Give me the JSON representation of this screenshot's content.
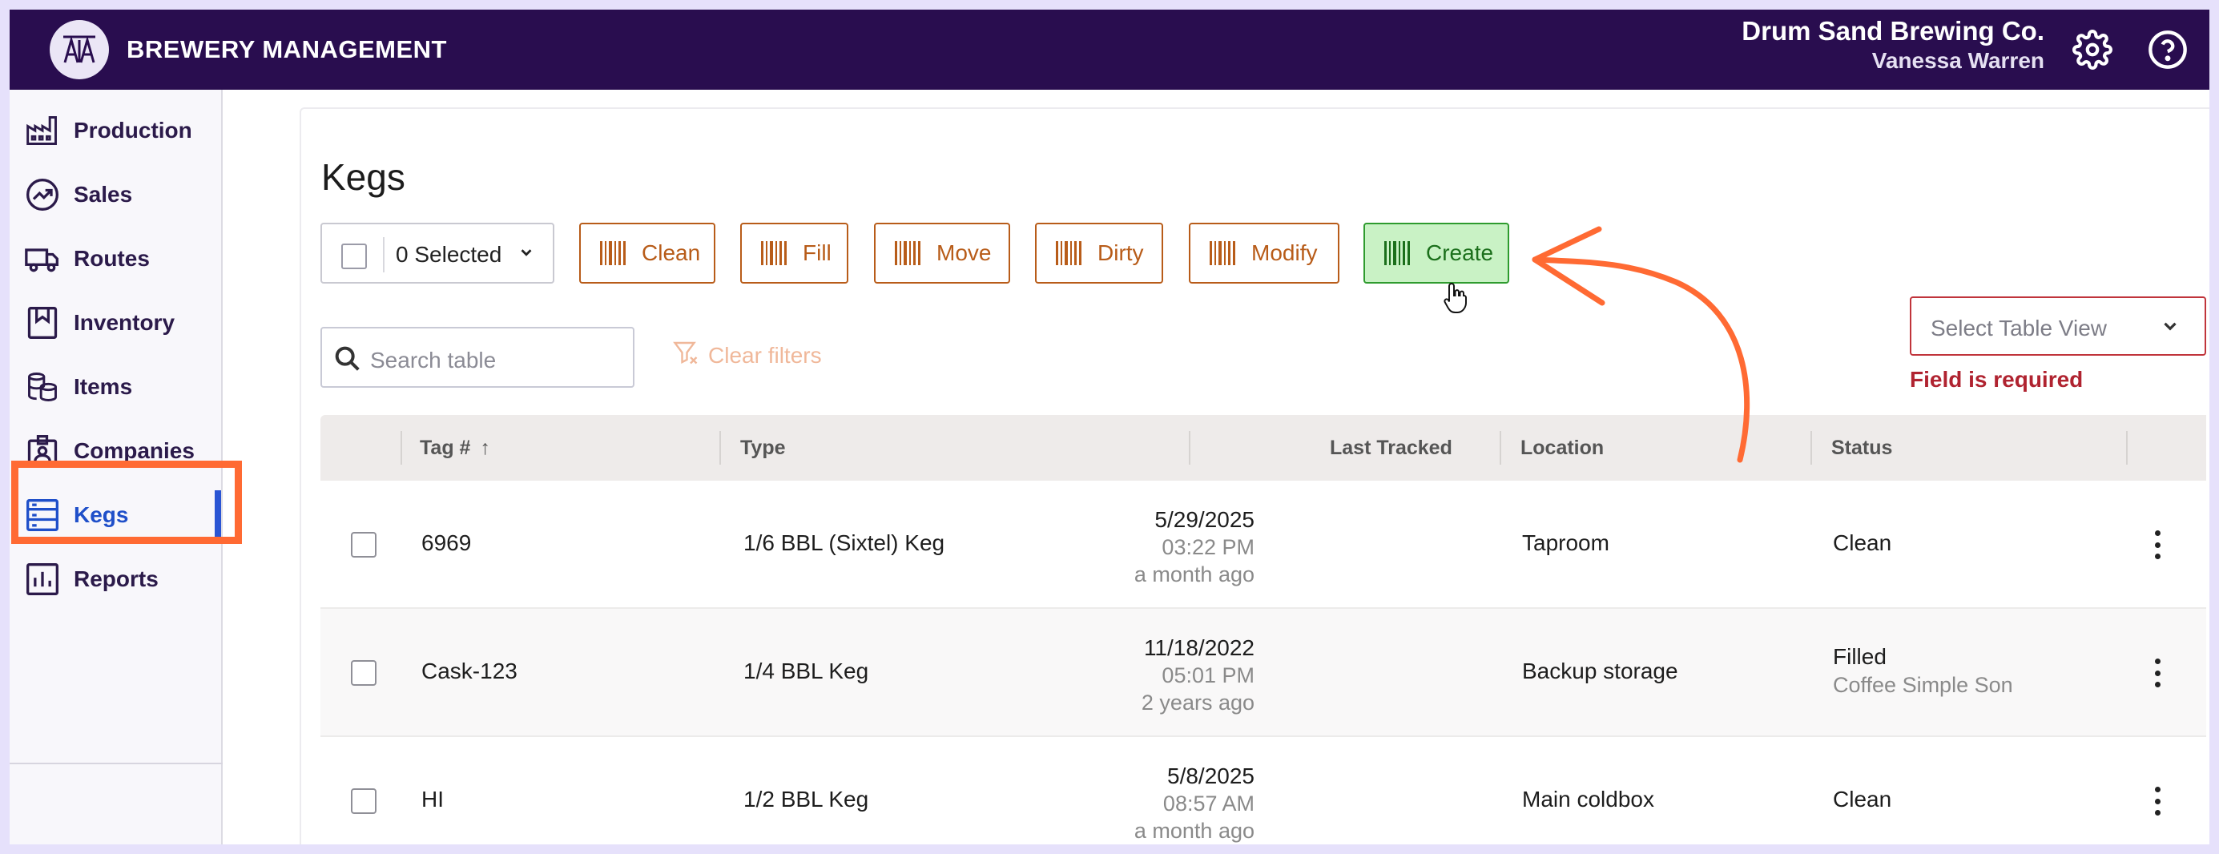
{
  "header": {
    "logo_text": "TAT",
    "app_title": "BREWERY MANAGEMENT",
    "company": "Drum Sand Brewing Co.",
    "user": "Vanessa Warren"
  },
  "sidebar": {
    "items": [
      {
        "label": "Production",
        "icon": "factory-icon"
      },
      {
        "label": "Sales",
        "icon": "trending-up-icon"
      },
      {
        "label": "Routes",
        "icon": "truck-icon"
      },
      {
        "label": "Inventory",
        "icon": "bookmark-icon"
      },
      {
        "label": "Items",
        "icon": "kegs-stack-icon"
      },
      {
        "label": "Companies",
        "icon": "id-badge-icon"
      },
      {
        "label": "Kegs",
        "icon": "keg-list-icon",
        "active": true
      },
      {
        "label": "Reports",
        "icon": "bar-chart-icon"
      }
    ]
  },
  "page": {
    "title": "Kegs",
    "selection_label": "0 Selected",
    "actions": [
      "Clean",
      "Fill",
      "Move",
      "Dirty",
      "Modify",
      "Create"
    ],
    "search_placeholder": "Search table",
    "clear_filters": "Clear filters",
    "table_view_placeholder": "Select Table View",
    "table_view_error": "Field is required"
  },
  "table": {
    "columns": [
      "Tag #",
      "Type",
      "Last Tracked",
      "Location",
      "Status"
    ],
    "sort_indicator": "↑",
    "rows": [
      {
        "tag": "6969",
        "type": "1/6 BBL (Sixtel) Keg",
        "date": "5/29/2025",
        "time": "03:22 PM",
        "ago": "a month ago",
        "location": "Taproom",
        "status": "Clean",
        "status_sub": ""
      },
      {
        "tag": "Cask-123",
        "type": "1/4 BBL Keg",
        "date": "11/18/2022",
        "time": "05:01 PM",
        "ago": "2 years ago",
        "location": "Backup storage",
        "status": "Filled",
        "status_sub": "Coffee Simple Son"
      },
      {
        "tag": "HI",
        "type": "1/2 BBL Keg",
        "date": "5/8/2025",
        "time": "08:57 AM",
        "ago": "a month ago",
        "location": "Main coldbox",
        "status": "Clean",
        "status_sub": ""
      }
    ]
  },
  "colors": {
    "header_bg": "#290d4f",
    "accent_orange": "#b85c19",
    "create_green": "#2e9b2e",
    "annotation": "#ff6a33",
    "error_red": "#b02330",
    "active_blue": "#1f4fc9"
  }
}
